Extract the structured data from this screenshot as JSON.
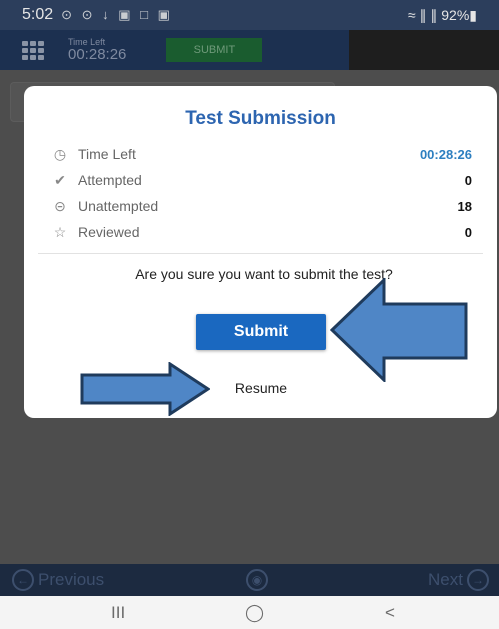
{
  "status_bar": {
    "time": "5:02",
    "notification_icons": "⊙ ⊙ ↓ ▣ □ ▣",
    "right": "≈ ∥ ∥ 92%▮"
  },
  "app_bar": {
    "time_left_label": "Time Left",
    "time_left_value": "00:28:26",
    "submit_label": "SUBMIT"
  },
  "modal": {
    "title": "Test Submission",
    "stats": [
      {
        "label": "Time Left",
        "value": "00:28:26",
        "icon": "alarm-clock-icon"
      },
      {
        "label": "Attempted",
        "value": "0",
        "icon": "check-circle-icon"
      },
      {
        "label": "Unattempted",
        "value": "18",
        "icon": "minus-circle-icon"
      },
      {
        "label": "Reviewed",
        "value": "0",
        "icon": "star-icon"
      }
    ],
    "question": "Are you sure you want to submit the test?",
    "submit_label": "Submit",
    "resume_label": "Resume"
  },
  "bottom_nav": {
    "previous_label": "Previous",
    "next_label": "Next"
  },
  "android_nav": {
    "recents": "III",
    "home": "◯",
    "back": "<"
  },
  "colors": {
    "accent_blue": "#1a68c0",
    "title_blue": "#2d65b0",
    "arrow_fill": "#4f86c6",
    "arrow_stroke": "#1f3b5c"
  }
}
